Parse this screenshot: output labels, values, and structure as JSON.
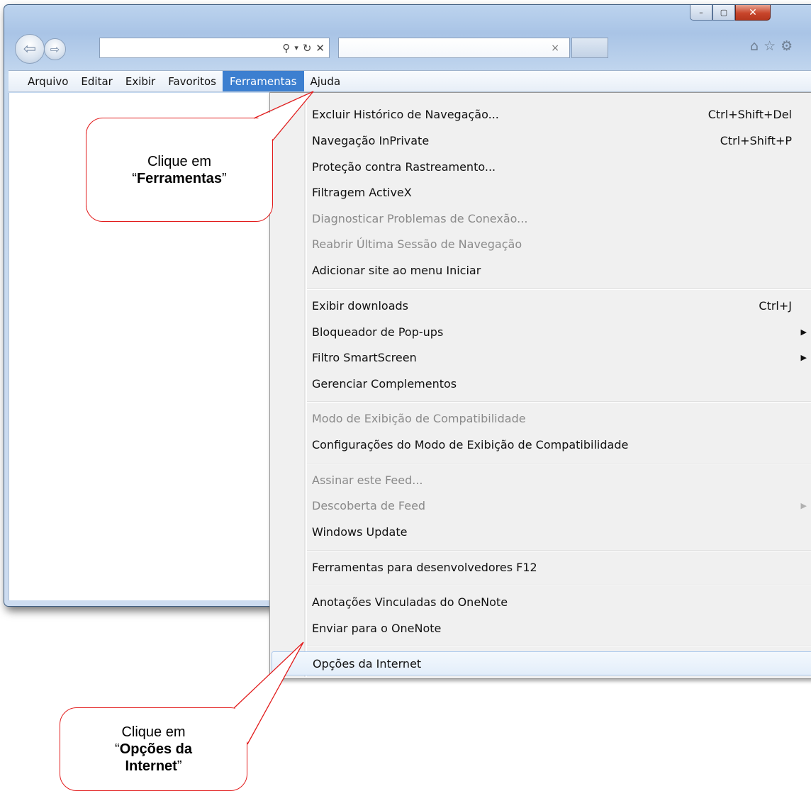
{
  "window": {
    "caption_buttons": {
      "minimize": "–",
      "maximize": "▢",
      "close": "✕"
    }
  },
  "toolbar": {
    "back_icon": "⇦",
    "forward_icon": "⇨",
    "address_controls": {
      "search": "⚲",
      "dropdown": "▾",
      "refresh": "↻",
      "stop": "✕"
    },
    "tab_close": "×",
    "icons": {
      "home": "⌂",
      "favorites": "☆",
      "tools": "⚙"
    }
  },
  "menubar": {
    "items": [
      "Arquivo",
      "Editar",
      "Exibir",
      "Favoritos",
      "Ferramentas",
      "Ajuda"
    ],
    "active": "Ferramentas"
  },
  "dropdown": {
    "items": [
      {
        "label": "Excluir Histórico de Navegação...",
        "shortcut": "Ctrl+Shift+Del"
      },
      {
        "label": "Navegação InPrivate",
        "shortcut": "Ctrl+Shift+P"
      },
      {
        "label": "Proteção contra Rastreamento..."
      },
      {
        "label": "Filtragem ActiveX"
      },
      {
        "label": "Diagnosticar Problemas de Conexão...",
        "disabled": true
      },
      {
        "label": "Reabrir Última Sessão de Navegação",
        "disabled": true
      },
      {
        "label": "Adicionar site ao menu Iniciar"
      },
      {
        "label": "Exibir downloads",
        "shortcut": "Ctrl+J"
      },
      {
        "label": "Bloqueador de Pop-ups",
        "submenu": true
      },
      {
        "label": "Filtro SmartScreen",
        "submenu": true
      },
      {
        "label": "Gerenciar Complementos"
      },
      {
        "label": "Modo de Exibição de Compatibilidade",
        "disabled": true
      },
      {
        "label": "Configurações do Modo de Exibição de Compatibilidade"
      },
      {
        "label": "Assinar este Feed...",
        "disabled": true
      },
      {
        "label": "Descoberta de Feed",
        "disabled": true,
        "submenu": true
      },
      {
        "label": "Windows Update"
      },
      {
        "label": "Ferramentas para desenvolvedores F12"
      },
      {
        "label": "Anotações Vinculadas do OneNote"
      },
      {
        "label": "Enviar para o OneNote"
      },
      {
        "label": "Opções da Internet",
        "highlighted": true
      }
    ],
    "submenu_arrow": "▶"
  },
  "callouts": {
    "ferramentas": {
      "line1": "Clique em",
      "open_quote": "“",
      "bold": "Ferramentas",
      "close_quote": "”"
    },
    "opcoes": {
      "line1": "Clique em",
      "open_quote": "“",
      "bold1": "Opções da",
      "bold2": "Internet",
      "close_quote": "”"
    }
  },
  "colors": {
    "menu_active": "#3c7fd0",
    "callout_border": "#e21c1c",
    "disabled_text": "#8a8a8a",
    "window_frame": "#bcd3ee"
  }
}
